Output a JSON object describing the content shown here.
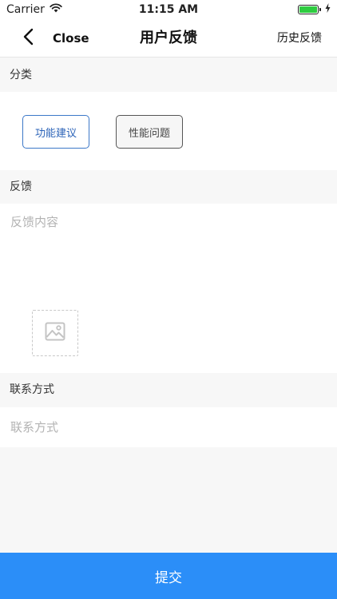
{
  "status_bar": {
    "carrier": "Carrier",
    "time": "11:15 AM",
    "battery_level": 1.0
  },
  "nav": {
    "close_label": "Close",
    "title": "用户反馈",
    "history_label": "历史反馈"
  },
  "category": {
    "header": "分类",
    "options": [
      {
        "label": "功能建议",
        "selected": true
      },
      {
        "label": "性能问题",
        "selected": false
      }
    ]
  },
  "feedback": {
    "header": "反馈",
    "placeholder": "反馈内容",
    "value": ""
  },
  "contact": {
    "header": "联系方式",
    "placeholder": "联系方式",
    "value": ""
  },
  "submit_label": "提交",
  "colors": {
    "accent": "#2b8ef8",
    "selected_border": "#3c78c8",
    "placeholder": "#b3b3b3",
    "background": "#f7f7f7"
  },
  "icons": {
    "back": "chevron-left-icon",
    "wifi": "wifi-icon",
    "battery": "battery-icon",
    "charging": "bolt-icon",
    "image_add": "image-icon"
  }
}
